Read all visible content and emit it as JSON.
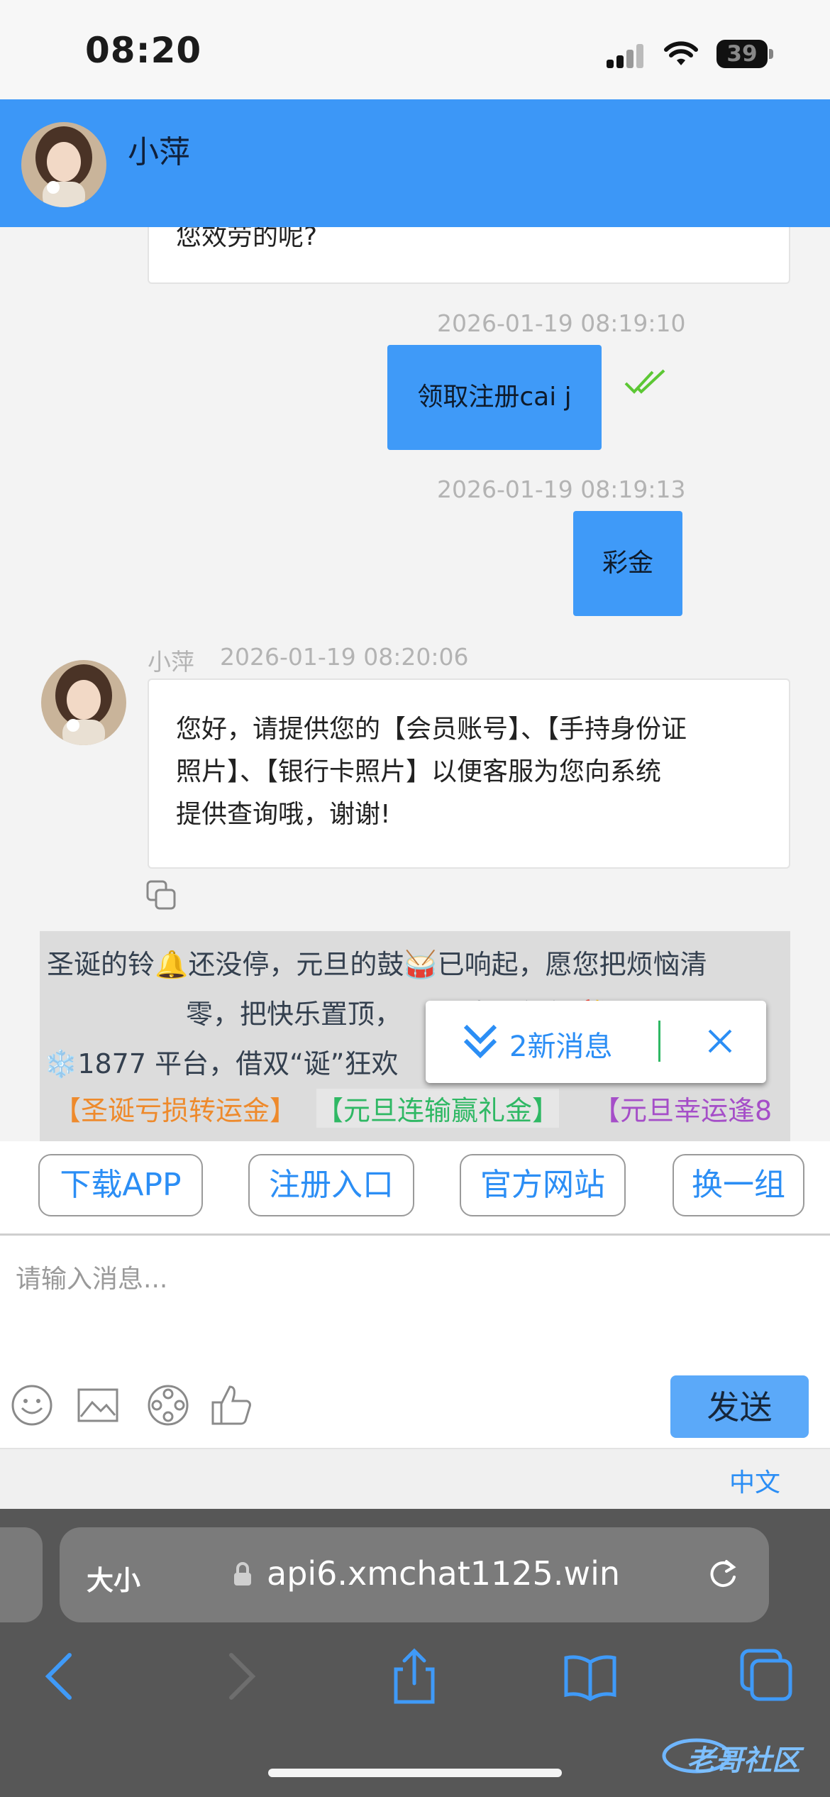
{
  "status_bar": {
    "time": "08:20",
    "battery": "39"
  },
  "header": {
    "name": "小萍"
  },
  "chat": {
    "partial_text": "您效劳的呢?",
    "messages": [
      {
        "timestamp": "2026-01-19 08:19:10",
        "text": "领取注册cai j"
      },
      {
        "timestamp": "2026-01-19 08:19:13",
        "text": "彩金"
      }
    ],
    "agent_message": {
      "sender": "小萍",
      "timestamp": "2026-01-19 08:20:06",
      "lines": [
        "您好，请提供您的【会员账号】、【手持身份证",
        "照片】、【银行卡照片】以便客服为您向系统",
        "提供查询哦，谢谢!"
      ]
    }
  },
  "notice": {
    "line1": "圣诞的铃🔔还没停，元旦的鼓🥁已响起，愿您把烦恼清",
    "line2": "零，把快乐置顶，",
    "line2_tail": "福步入新年🎉",
    "line3": "❄️1877 平台，借双“诞”狂欢",
    "promos": [
      "【圣诞亏损转运金】",
      "【元旦连输赢礼金】",
      "【元旦幸运逢8"
    ]
  },
  "new_messages_label": "2新消息",
  "quick_buttons": [
    "下载APP",
    "注册入口",
    "官方网站",
    "换一组"
  ],
  "input": {
    "placeholder": "请输入消息..."
  },
  "send_label": "发送",
  "language": "中文",
  "safari": {
    "aa": "大小",
    "url": "api6.xmchat1125.win"
  },
  "watermark": "老哥社区",
  "colors": {
    "accent": "#3c97f7",
    "link": "#2b8ef5",
    "check": "#5cc734"
  }
}
